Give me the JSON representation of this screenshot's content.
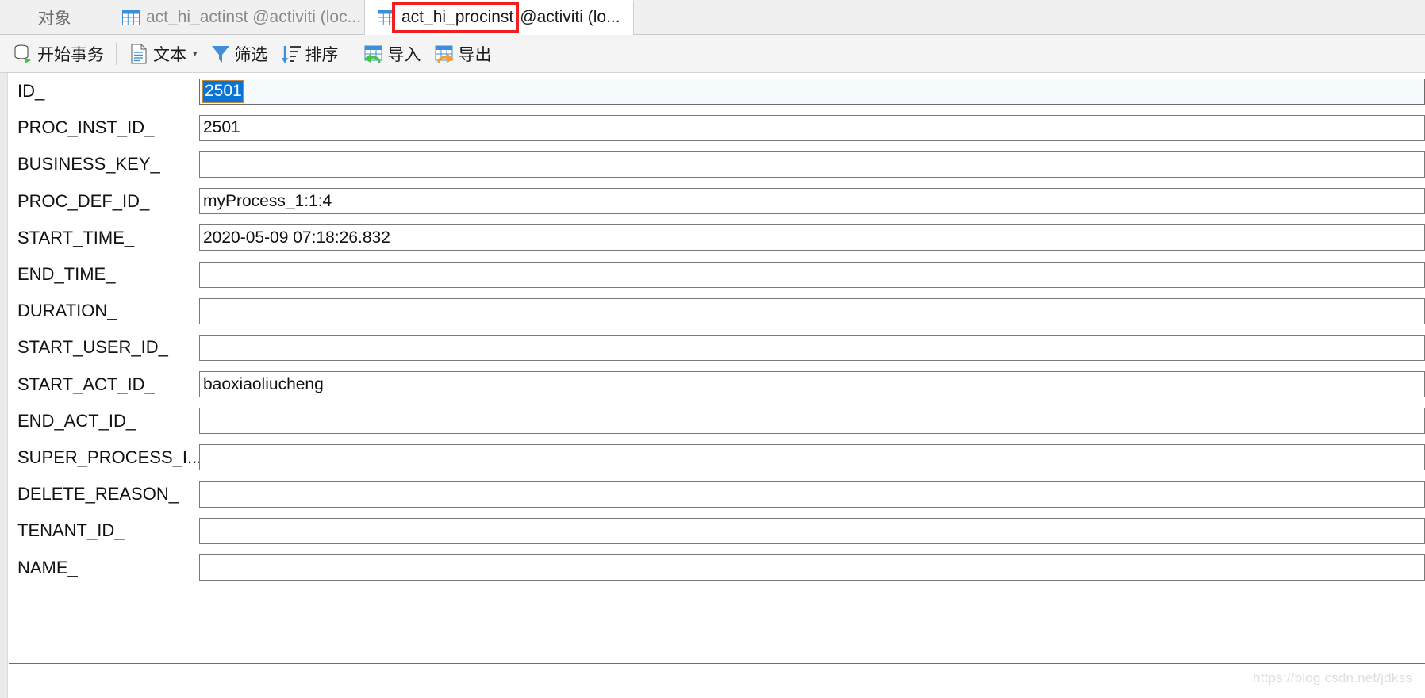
{
  "window": {
    "app_kind": "database-table-form-view"
  },
  "tabs": [
    {
      "label": "对象",
      "icon": "",
      "active": false
    },
    {
      "label": "act_hi_actinst @activiti (loc...",
      "icon": "grid-icon",
      "active": false
    },
    {
      "label_highlighted": "act_hi_procinst",
      "label_rest": "@activiti (lo...",
      "icon": "grid-icon",
      "active": true
    }
  ],
  "annotation": {
    "type": "red-rectangle",
    "color": "#f21f1f",
    "target": "act_hi_procinst"
  },
  "toolbar": {
    "items": [
      {
        "label": "开始事务",
        "icon": "begin-transaction-icon"
      },
      {
        "label": "文本",
        "icon": "text-icon",
        "caret": "▾"
      },
      {
        "label": "筛选",
        "icon": "filter-icon"
      },
      {
        "label": "排序",
        "icon": "sort-icon"
      },
      {
        "label": "导入",
        "icon": "import-icon"
      },
      {
        "label": "导出",
        "icon": "export-icon"
      }
    ]
  },
  "form": {
    "fields": [
      {
        "label": "ID_",
        "value": "2501",
        "selected": true,
        "focused": true
      },
      {
        "label": "PROC_INST_ID_",
        "value": "2501",
        "selected": false,
        "focused": false
      },
      {
        "label": "BUSINESS_KEY_",
        "value": "",
        "selected": false,
        "focused": false
      },
      {
        "label": "PROC_DEF_ID_",
        "value": "myProcess_1:1:4",
        "selected": false,
        "focused": false
      },
      {
        "label": "START_TIME_",
        "value": "2020-05-09 07:18:26.832",
        "selected": false,
        "focused": false
      },
      {
        "label": "END_TIME_",
        "value": "",
        "selected": false,
        "focused": false
      },
      {
        "label": "DURATION_",
        "value": "",
        "selected": false,
        "focused": false
      },
      {
        "label": "START_USER_ID_",
        "value": "",
        "selected": false,
        "focused": false
      },
      {
        "label": "START_ACT_ID_",
        "value": "baoxiaoliucheng",
        "selected": false,
        "focused": false
      },
      {
        "label": "END_ACT_ID_",
        "value": "",
        "selected": false,
        "focused": false
      },
      {
        "label": "SUPER_PROCESS_I...",
        "value": "",
        "selected": false,
        "focused": false
      },
      {
        "label": "DELETE_REASON_",
        "value": "",
        "selected": false,
        "focused": false
      },
      {
        "label": "TENANT_ID_",
        "value": "",
        "selected": false,
        "focused": false
      },
      {
        "label": "NAME_",
        "value": "",
        "selected": false,
        "focused": false
      }
    ]
  },
  "watermark": {
    "text": "https://blog.csdn.net/jdkss"
  },
  "colors": {
    "selection_blue": "#0a74d6",
    "annotation_red": "#f21f1f",
    "focus_field_bg": "#f5fafd",
    "toolbar_bg": "#f4f4f4",
    "tabbar_bg": "#f0f0f0"
  }
}
